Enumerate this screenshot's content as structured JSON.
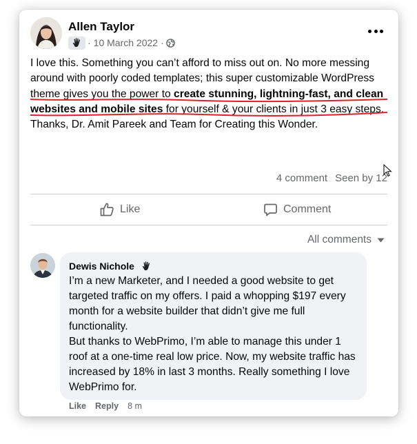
{
  "post": {
    "author": "Allen Taylor",
    "date": "10 March 2022",
    "separator": "·",
    "text_part1": "I love this. Something you can’t afford to miss out on. No more messing around with poorly coded templates; this super customizable WordPress theme gives you the power to ",
    "text_bold": "create stunning, lightning-fast, and clean websites and mobile sites",
    "text_part2": " for yourself & your clients in just 3 easy steps. Thanks, Dr. Amit Pareek and Team for Creating this Wonder.",
    "comment_count": "4 comment",
    "seen_by": "Seen by 12"
  },
  "actions": {
    "like_label": "Like",
    "comment_label": "Comment"
  },
  "comments_filter": {
    "label": "All comments"
  },
  "comment": {
    "author": "Dewis Nichole",
    "text_line1": "I’m a new Marketer, and I needed a good website to get targeted traffic on my offers. I paid a whopping $197 every month for a website builder that didn’t give me full functionality.",
    "text_line2": "But thanks to WebPrimo, I’m able to manage this under 1 roof at a one-time real low price. Now, my website traffic has increased by 18% in last 3 months. Really something I love WebPrimo for.",
    "like_label": "Like",
    "reply_label": "Reply",
    "time": "8 m"
  },
  "colors": {
    "accent_underline": "#d8232a",
    "secondary_text": "#65676b",
    "bubble_bg": "#f0f2f5"
  },
  "icons": {
    "badge": "waving-hand-icon",
    "privacy": "globe-icon",
    "more": "more-options-icon",
    "like": "thumbs-up-icon",
    "comment": "speech-bubble-icon",
    "dropdown": "caret-down-icon"
  }
}
